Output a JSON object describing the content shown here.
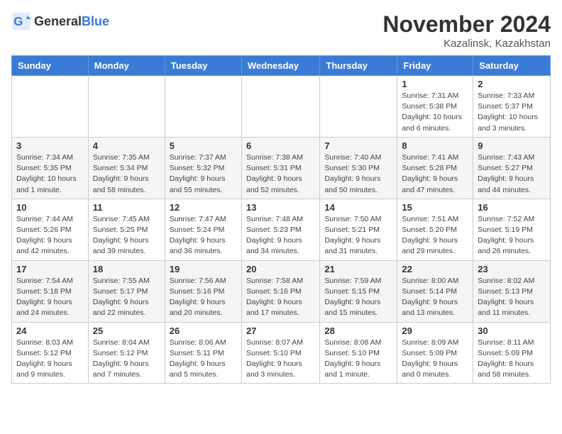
{
  "header": {
    "logo_general": "General",
    "logo_blue": "Blue",
    "month_year": "November 2024",
    "location": "Kazalinsk, Kazakhstan"
  },
  "weekdays": [
    "Sunday",
    "Monday",
    "Tuesday",
    "Wednesday",
    "Thursday",
    "Friday",
    "Saturday"
  ],
  "weeks": [
    [
      {
        "day": "",
        "info": ""
      },
      {
        "day": "",
        "info": ""
      },
      {
        "day": "",
        "info": ""
      },
      {
        "day": "",
        "info": ""
      },
      {
        "day": "",
        "info": ""
      },
      {
        "day": "1",
        "info": "Sunrise: 7:31 AM\nSunset: 5:38 PM\nDaylight: 10 hours and 6 minutes."
      },
      {
        "day": "2",
        "info": "Sunrise: 7:33 AM\nSunset: 5:37 PM\nDaylight: 10 hours and 3 minutes."
      }
    ],
    [
      {
        "day": "3",
        "info": "Sunrise: 7:34 AM\nSunset: 5:35 PM\nDaylight: 10 hours and 1 minute."
      },
      {
        "day": "4",
        "info": "Sunrise: 7:35 AM\nSunset: 5:34 PM\nDaylight: 9 hours and 58 minutes."
      },
      {
        "day": "5",
        "info": "Sunrise: 7:37 AM\nSunset: 5:32 PM\nDaylight: 9 hours and 55 minutes."
      },
      {
        "day": "6",
        "info": "Sunrise: 7:38 AM\nSunset: 5:31 PM\nDaylight: 9 hours and 52 minutes."
      },
      {
        "day": "7",
        "info": "Sunrise: 7:40 AM\nSunset: 5:30 PM\nDaylight: 9 hours and 50 minutes."
      },
      {
        "day": "8",
        "info": "Sunrise: 7:41 AM\nSunset: 5:28 PM\nDaylight: 9 hours and 47 minutes."
      },
      {
        "day": "9",
        "info": "Sunrise: 7:43 AM\nSunset: 5:27 PM\nDaylight: 9 hours and 44 minutes."
      }
    ],
    [
      {
        "day": "10",
        "info": "Sunrise: 7:44 AM\nSunset: 5:26 PM\nDaylight: 9 hours and 42 minutes."
      },
      {
        "day": "11",
        "info": "Sunrise: 7:45 AM\nSunset: 5:25 PM\nDaylight: 9 hours and 39 minutes."
      },
      {
        "day": "12",
        "info": "Sunrise: 7:47 AM\nSunset: 5:24 PM\nDaylight: 9 hours and 36 minutes."
      },
      {
        "day": "13",
        "info": "Sunrise: 7:48 AM\nSunset: 5:23 PM\nDaylight: 9 hours and 34 minutes."
      },
      {
        "day": "14",
        "info": "Sunrise: 7:50 AM\nSunset: 5:21 PM\nDaylight: 9 hours and 31 minutes."
      },
      {
        "day": "15",
        "info": "Sunrise: 7:51 AM\nSunset: 5:20 PM\nDaylight: 9 hours and 29 minutes."
      },
      {
        "day": "16",
        "info": "Sunrise: 7:52 AM\nSunset: 5:19 PM\nDaylight: 9 hours and 26 minutes."
      }
    ],
    [
      {
        "day": "17",
        "info": "Sunrise: 7:54 AM\nSunset: 5:18 PM\nDaylight: 9 hours and 24 minutes."
      },
      {
        "day": "18",
        "info": "Sunrise: 7:55 AM\nSunset: 5:17 PM\nDaylight: 9 hours and 22 minutes."
      },
      {
        "day": "19",
        "info": "Sunrise: 7:56 AM\nSunset: 5:16 PM\nDaylight: 9 hours and 20 minutes."
      },
      {
        "day": "20",
        "info": "Sunrise: 7:58 AM\nSunset: 5:16 PM\nDaylight: 9 hours and 17 minutes."
      },
      {
        "day": "21",
        "info": "Sunrise: 7:59 AM\nSunset: 5:15 PM\nDaylight: 9 hours and 15 minutes."
      },
      {
        "day": "22",
        "info": "Sunrise: 8:00 AM\nSunset: 5:14 PM\nDaylight: 9 hours and 13 minutes."
      },
      {
        "day": "23",
        "info": "Sunrise: 8:02 AM\nSunset: 5:13 PM\nDaylight: 9 hours and 11 minutes."
      }
    ],
    [
      {
        "day": "24",
        "info": "Sunrise: 8:03 AM\nSunset: 5:12 PM\nDaylight: 9 hours and 9 minutes."
      },
      {
        "day": "25",
        "info": "Sunrise: 8:04 AM\nSunset: 5:12 PM\nDaylight: 9 hours and 7 minutes."
      },
      {
        "day": "26",
        "info": "Sunrise: 8:06 AM\nSunset: 5:11 PM\nDaylight: 9 hours and 5 minutes."
      },
      {
        "day": "27",
        "info": "Sunrise: 8:07 AM\nSunset: 5:10 PM\nDaylight: 9 hours and 3 minutes."
      },
      {
        "day": "28",
        "info": "Sunrise: 8:08 AM\nSunset: 5:10 PM\nDaylight: 9 hours and 1 minute."
      },
      {
        "day": "29",
        "info": "Sunrise: 8:09 AM\nSunset: 5:09 PM\nDaylight: 9 hours and 0 minutes."
      },
      {
        "day": "30",
        "info": "Sunrise: 8:11 AM\nSunset: 5:09 PM\nDaylight: 8 hours and 58 minutes."
      }
    ]
  ]
}
